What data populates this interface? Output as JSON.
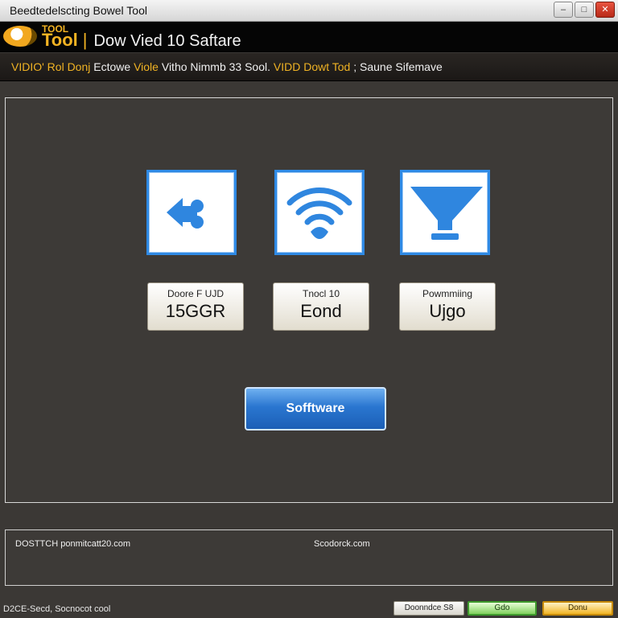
{
  "window": {
    "title": "Beedtedelscting Bowel Tool",
    "controls": {
      "minimize": "–",
      "maximize": "□",
      "close": "✕"
    }
  },
  "header": {
    "logo_text": "TOOL",
    "brand_word": "Tool",
    "brand_separator": "|",
    "brand_rest": "Dow Vied 10 Saftare"
  },
  "tagline": {
    "part_a": "VIDIO' Rol Donj",
    "part_b": " Ectowe ",
    "part_c": "Viole",
    "part_d": " Vitho Nimmb 33 Sool.",
    "part_e": "  VIDD Dowt Tod",
    "part_f": " ; Saune Sifemave"
  },
  "icons": [
    {
      "name": "puzzle-arrow-icon"
    },
    {
      "name": "wifi-icon"
    },
    {
      "name": "funnel-icon"
    }
  ],
  "cards": [
    {
      "label": "Doore F UJD",
      "value": "15GGR"
    },
    {
      "label": "Tnocl 10",
      "value": "Eond"
    },
    {
      "label": "Powmmiing",
      "value": "Ujgo"
    }
  ],
  "primary_button": {
    "label": "Sofftware"
  },
  "status": {
    "left": "DOSTTCH ponmitcatt20.com",
    "right": "Scodorck.com"
  },
  "footer": {
    "text": "D2CE-Secd, Socnocot cool",
    "buttons": [
      "Doonndce S8",
      "Gdo",
      "Donu"
    ]
  },
  "colors": {
    "accent": "#f0b324",
    "tile_border": "#2f8ae5",
    "button_blue": "#2a76d0"
  }
}
